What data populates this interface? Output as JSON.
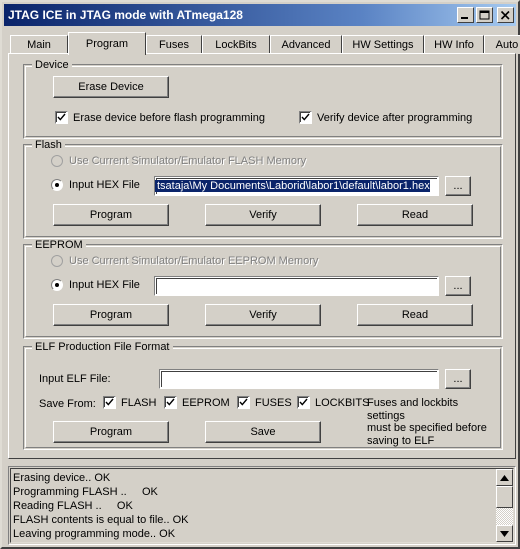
{
  "window": {
    "title": "JTAG ICE in JTAG mode with ATmega128",
    "minimize_label": "Minimize",
    "maximize_label": "Maximize",
    "close_label": "Close",
    "titlebar_gradient_start": "#0a246a",
    "titlebar_gradient_end": "#a6caf0",
    "face_color": "#d4d0c8"
  },
  "tabs": [
    {
      "label": "Main",
      "active": false
    },
    {
      "label": "Program",
      "active": true
    },
    {
      "label": "Fuses",
      "active": false
    },
    {
      "label": "LockBits",
      "active": false
    },
    {
      "label": "Advanced",
      "active": false
    },
    {
      "label": "HW Settings",
      "active": false
    },
    {
      "label": "HW Info",
      "active": false
    },
    {
      "label": "Auto",
      "active": false
    }
  ],
  "device": {
    "group_title": "Device",
    "erase_button": "Erase Device",
    "erase_before_flash": {
      "label": "Erase device before flash programming",
      "checked": true
    },
    "verify_after": {
      "label": "Verify device after programming",
      "checked": true
    }
  },
  "flash": {
    "group_title": "Flash",
    "use_current_memory": {
      "label": "Use Current Simulator/Emulator FLASH Memory",
      "selected": false,
      "disabled": true
    },
    "input_hex": {
      "label": "Input HEX File",
      "selected": true,
      "value": "tsataja\\My Documents\\Laborid\\labor1\\default\\labor1.hex",
      "placeholder": "",
      "text_selected": true
    },
    "browse_button": "...",
    "program_button": "Program",
    "verify_button": "Verify",
    "read_button": "Read"
  },
  "eeprom": {
    "group_title": "EEPROM",
    "use_current_memory": {
      "label": "Use Current Simulator/Emulator EEPROM Memory",
      "selected": false,
      "disabled": true
    },
    "input_hex": {
      "label": "Input HEX File",
      "selected": true,
      "value": "",
      "placeholder": "",
      "text_selected": false
    },
    "browse_button": "...",
    "program_button": "Program",
    "verify_button": "Verify",
    "read_button": "Read"
  },
  "elf": {
    "group_title": "ELF Production File Format",
    "input_label": "Input ELF File:",
    "input_value": "",
    "input_placeholder": "",
    "browse_button": "...",
    "save_from_label": "Save From:",
    "save_from": [
      {
        "label": "FLASH",
        "checked": true
      },
      {
        "label": "EEPROM",
        "checked": true
      },
      {
        "label": "FUSES",
        "checked": true
      },
      {
        "label": "LOCKBITS",
        "checked": true
      }
    ],
    "program_button": "Program",
    "save_button": "Save",
    "hint": "Fuses and lockbits settings\nmust be specified before\nsaving to ELF"
  },
  "log": {
    "lines": [
      "Erasing device.. OK",
      "Programming FLASH ..     OK",
      "Reading FLASH ..     OK",
      "FLASH contents is equal to file.. OK",
      "Leaving programming mode.. OK"
    ],
    "scroll_up_label": "Scroll up",
    "scroll_down_label": "Scroll down"
  }
}
